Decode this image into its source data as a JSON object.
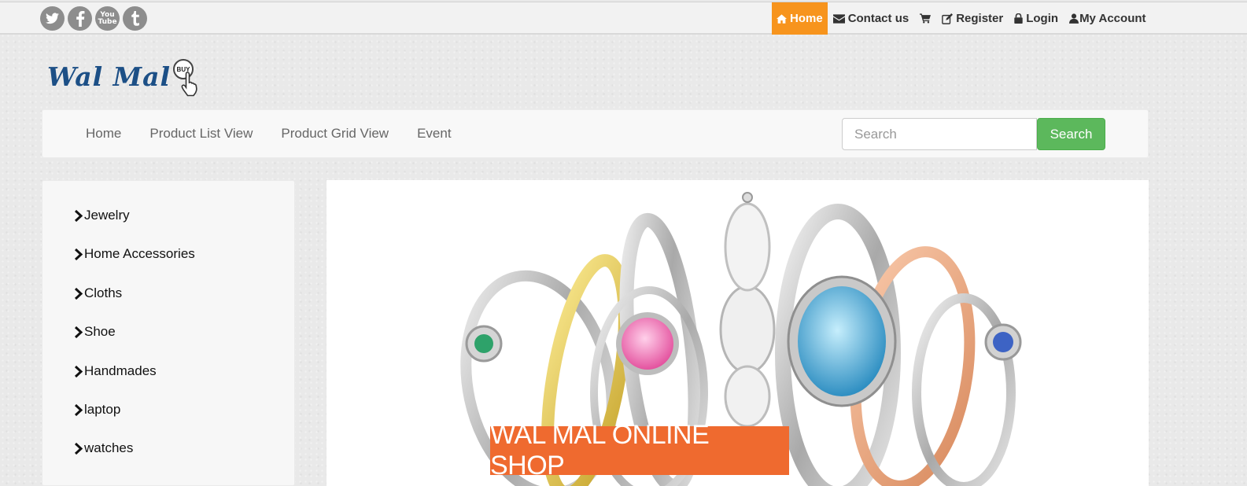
{
  "social": [
    {
      "name": "twitter-icon",
      "glyph": "t"
    },
    {
      "name": "facebook-icon",
      "glyph": "f"
    },
    {
      "name": "youtube-icon",
      "glyph": "You Tube"
    },
    {
      "name": "tumblr-icon",
      "glyph": "t"
    }
  ],
  "topnav": {
    "home": "Home",
    "contact": "Contact us",
    "register": "Register",
    "login": "Login",
    "account": "My Account",
    "active_color": "#f7941d"
  },
  "logo": {
    "text": "Wal Mal",
    "badge": "BUY",
    "color": "#1c4f86"
  },
  "mainnav": {
    "links": [
      "Home",
      "Product List View",
      "Product Grid View",
      "Event"
    ],
    "search_placeholder": "Search",
    "search_button": "Search",
    "button_color": "#5cb85c"
  },
  "categories": [
    "Jewelry",
    "Home Accessories",
    "Cloths",
    "Shoe",
    "Handmades",
    "laptop",
    "watches"
  ],
  "banner": {
    "caption": "WAL MAL ONLINE SHOP",
    "caption_color": "#ef6a2f"
  }
}
